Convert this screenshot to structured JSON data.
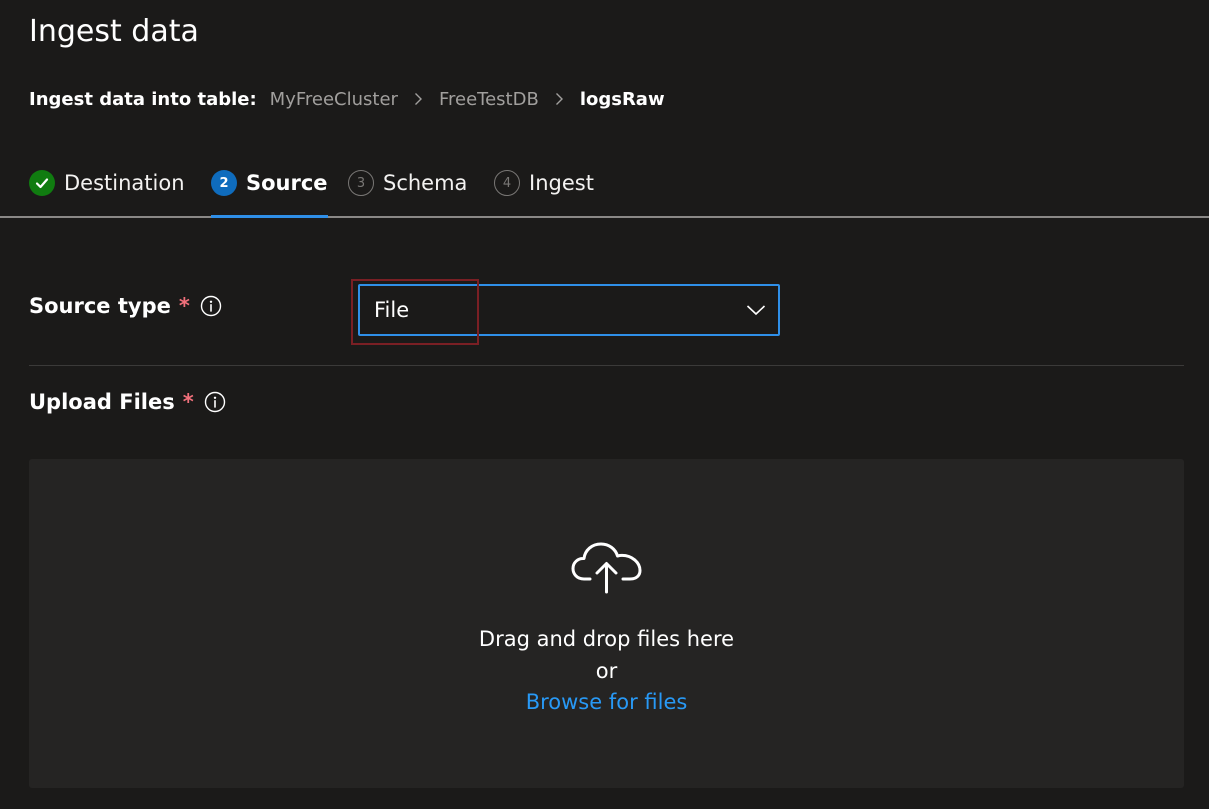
{
  "page": {
    "title": "Ingest data"
  },
  "breadcrumb": {
    "label": "Ingest data into table:",
    "items": [
      "MyFreeCluster",
      "FreeTestDB"
    ],
    "current": "logsRaw"
  },
  "steps": [
    {
      "number": "",
      "label": "Destination",
      "status": "completed",
      "icon": "checkmark-icon"
    },
    {
      "number": "2",
      "label": "Source",
      "status": "active"
    },
    {
      "number": "3",
      "label": "Schema",
      "status": "pending"
    },
    {
      "number": "4",
      "label": "Ingest",
      "status": "pending"
    }
  ],
  "source_type": {
    "label": "Source type",
    "required_mark": "*",
    "selected_value": "File",
    "icon": "chevron-down-icon"
  },
  "upload_files": {
    "label": "Upload Files",
    "required_mark": "*",
    "drop_text": "Drag and drop files here",
    "or_text": "or",
    "browse_link": "Browse for files",
    "icon": "cloud-upload-icon"
  },
  "colors": {
    "background": "#1b1a19",
    "accent": "#2f8fe8",
    "link": "#2899f5",
    "success": "#107c10",
    "required": "#f1707b",
    "highlight": "#7a1f24"
  }
}
